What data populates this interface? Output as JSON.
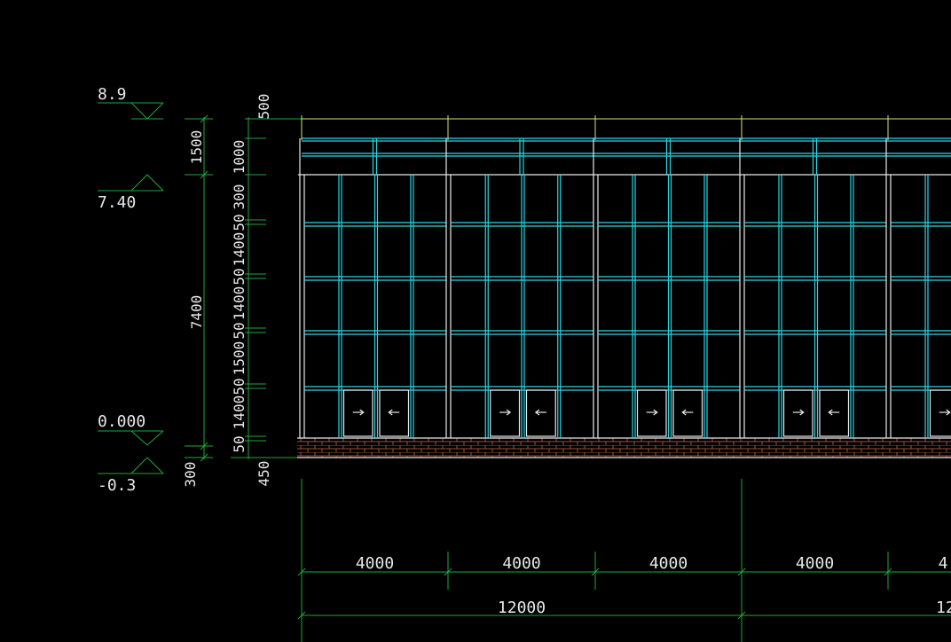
{
  "levels": [
    {
      "label": "8.9"
    },
    {
      "label": "7.40"
    },
    {
      "label": "0.000"
    },
    {
      "label": "-0.3"
    }
  ],
  "left_dims": [
    {
      "label": "1500"
    },
    {
      "label": "7400"
    },
    {
      "label": "300"
    }
  ],
  "inner_dims": [
    {
      "label": "500"
    },
    {
      "label": "1000"
    },
    {
      "label": "300"
    },
    {
      "label": "50"
    },
    {
      "label": "1400"
    },
    {
      "label": "50"
    },
    {
      "label": "1400"
    },
    {
      "label": "50"
    },
    {
      "label": "1500"
    },
    {
      "label": "50"
    },
    {
      "label": "1400"
    },
    {
      "label": "50"
    },
    {
      "label": "450"
    }
  ],
  "bay_dims": [
    "4000",
    "4000",
    "4000",
    "4000",
    "4"
  ],
  "total_dims": [
    "12000",
    "12"
  ],
  "colors": {
    "background": "#000000",
    "dimension": "#1fa83a",
    "mullion": "#28d6e6",
    "frame": "#e8e8e8",
    "parapet": "#d8e27a",
    "brick": "#e07a3a"
  }
}
